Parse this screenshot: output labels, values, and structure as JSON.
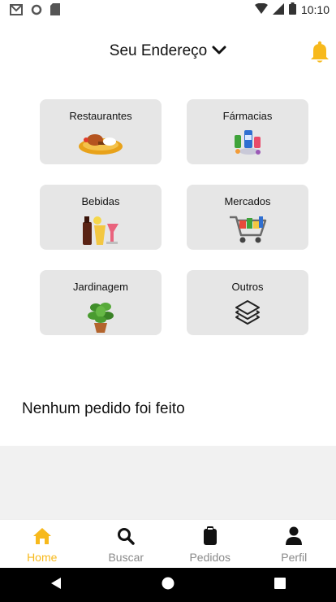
{
  "status_bar": {
    "time": "10:10",
    "icons": [
      "gmail-icon",
      "circle-icon",
      "sd-card-icon",
      "wifi-icon",
      "signal-icon",
      "battery-icon"
    ]
  },
  "header": {
    "address_label": "Seu Endereço",
    "icon": "chevron-down-icon",
    "bell_icon": "bell-icon"
  },
  "categories": [
    {
      "label": "Restaurantes",
      "icon": "food-plate-icon"
    },
    {
      "label": "Fármacias",
      "icon": "medicine-icon"
    },
    {
      "label": "Bebidas",
      "icon": "drinks-icon"
    },
    {
      "label": "Mercados",
      "icon": "shopping-cart-icon"
    },
    {
      "label": "Jardinagem",
      "icon": "potted-plant-icon"
    },
    {
      "label": "Outros",
      "icon": "layers-icon"
    }
  ],
  "orders": {
    "empty_message": "Nenhum pedido foi feito"
  },
  "bottom_nav": {
    "active_color": "#f7b91c",
    "items": [
      {
        "label": "Home",
        "icon": "home-icon",
        "active": true
      },
      {
        "label": "Buscar",
        "icon": "search-icon",
        "active": false
      },
      {
        "label": "Pedidos",
        "icon": "clipboard-icon",
        "active": false
      },
      {
        "label": "Perfil",
        "icon": "person-icon",
        "active": false
      }
    ]
  },
  "system_nav": {
    "icons": [
      "back-icon",
      "home-circle-icon",
      "recents-icon"
    ]
  }
}
